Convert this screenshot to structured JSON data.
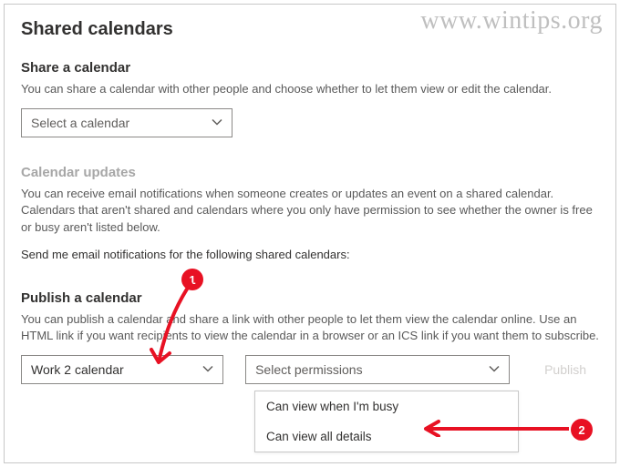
{
  "watermark": "www.wintips.org",
  "page_title": "Shared calendars",
  "share": {
    "heading": "Share a calendar",
    "description": "You can share a calendar with other people and choose whether to let them view or edit the calendar.",
    "select_placeholder": "Select a calendar"
  },
  "updates": {
    "heading": "Calendar updates",
    "description": "You can receive email notifications when someone creates or updates an event on a shared calendar. Calendars that aren't shared and calendars where you only have permission to see whether the owner is free or busy aren't listed below.",
    "instruction": "Send me email notifications for the following shared calendars:"
  },
  "publish": {
    "heading": "Publish a calendar",
    "description": "You can publish a calendar and share a link with other people to let them view the calendar online. Use an HTML link if you want recipients to view the calendar in a browser or an ICS link if you want them to subscribe.",
    "calendar_selected": "Work 2 calendar",
    "permission_placeholder": "Select permissions",
    "publish_label": "Publish",
    "options": [
      "Can view when I'm busy",
      "Can view all details"
    ]
  },
  "annotations": {
    "badge1": "1",
    "badge2": "2"
  }
}
